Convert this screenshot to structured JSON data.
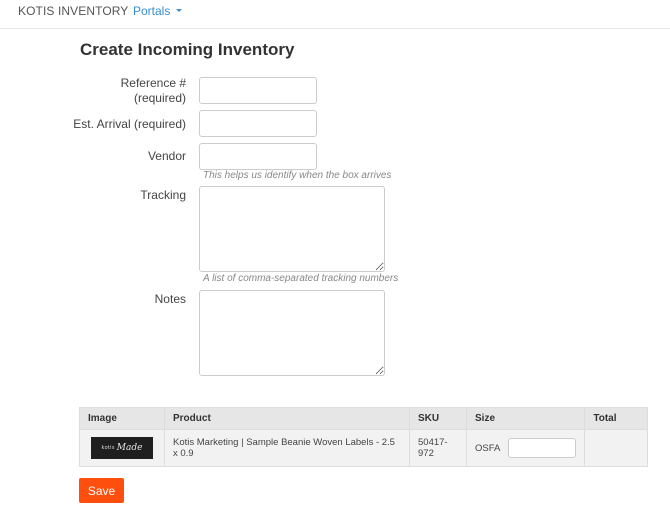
{
  "navbar": {
    "brand": "KOTIS INVENTORY",
    "portals_label": "Portals"
  },
  "page": {
    "title": "Create Incoming Inventory"
  },
  "form": {
    "reference": {
      "label_line1": "Reference #",
      "label_line2": "(required)",
      "value": ""
    },
    "est_arrival": {
      "label": "Est. Arrival (required)",
      "value": ""
    },
    "vendor": {
      "label": "Vendor",
      "value": "",
      "help": "This helps us identify when the box arrives"
    },
    "tracking": {
      "label": "Tracking",
      "value": "",
      "help": "A list of comma-separated tracking numbers"
    },
    "notes": {
      "label": "Notes",
      "value": ""
    }
  },
  "table": {
    "headers": [
      "Image",
      "Product",
      "SKU",
      "Size",
      "Total"
    ],
    "rows": [
      {
        "image_alt": "Kotis Made logo",
        "image_logo_a": "kotis",
        "image_logo_b": "Made",
        "product": "Kotis Marketing | Sample Beanie Woven Labels - 2.5 x 0.9",
        "sku": "50417-972",
        "size": "OSFA",
        "size_qty": "",
        "total": ""
      }
    ]
  },
  "actions": {
    "save_label": "Save"
  },
  "colors": {
    "accent": "#ff4f0f",
    "link": "#3a8cd0"
  }
}
